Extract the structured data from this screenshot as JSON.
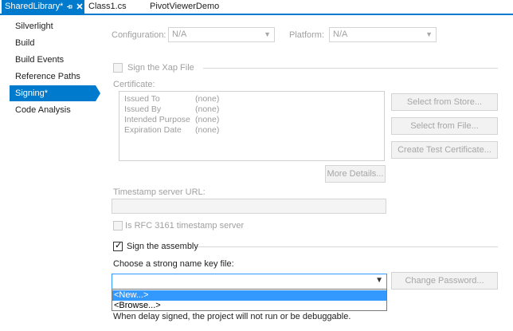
{
  "tabs": [
    {
      "label": "SharedLibrary*"
    },
    {
      "label": "Class1.cs"
    },
    {
      "label": "PivotViewerDemo"
    }
  ],
  "sidebar": {
    "items": [
      {
        "label": "Silverlight"
      },
      {
        "label": "Build"
      },
      {
        "label": "Build Events"
      },
      {
        "label": "Reference Paths"
      },
      {
        "label": "Signing*"
      },
      {
        "label": "Code Analysis"
      }
    ],
    "selected_index": 4
  },
  "config": {
    "configuration_label": "Configuration:",
    "configuration_value": "N/A",
    "platform_label": "Platform:",
    "platform_value": "N/A"
  },
  "xap": {
    "sign_label": "Sign the Xap File",
    "checked": false,
    "certificate_label": "Certificate:",
    "cert_fields": [
      {
        "name": "Issued To",
        "value": "(none)"
      },
      {
        "name": "Issued By",
        "value": "(none)"
      },
      {
        "name": "Intended Purpose",
        "value": "(none)"
      },
      {
        "name": "Expiration Date",
        "value": "(none)"
      }
    ],
    "select_from_store": "Select from Store...",
    "select_from_file": "Select from File...",
    "create_test_cert": "Create Test Certificate...",
    "more_details": "More Details...",
    "timestamp_label": "Timestamp server URL:",
    "timestamp_value": "",
    "rfc_label": "Is RFC 3161 timestamp server",
    "rfc_checked": false
  },
  "assembly": {
    "sign_label": "Sign the assembly",
    "checked": true,
    "key_file_label": "Choose a strong name key file:",
    "key_file_value": "",
    "change_password": "Change Password...",
    "dropdown_options": [
      "<New...>",
      "<Browse...>"
    ],
    "highlighted_option": 0,
    "delay_note": "When delay signed, the project will not run or be debuggable."
  },
  "colors": {
    "accent": "#007acc",
    "highlight": "#3399ff",
    "disabled_text": "#a0a0a0"
  }
}
